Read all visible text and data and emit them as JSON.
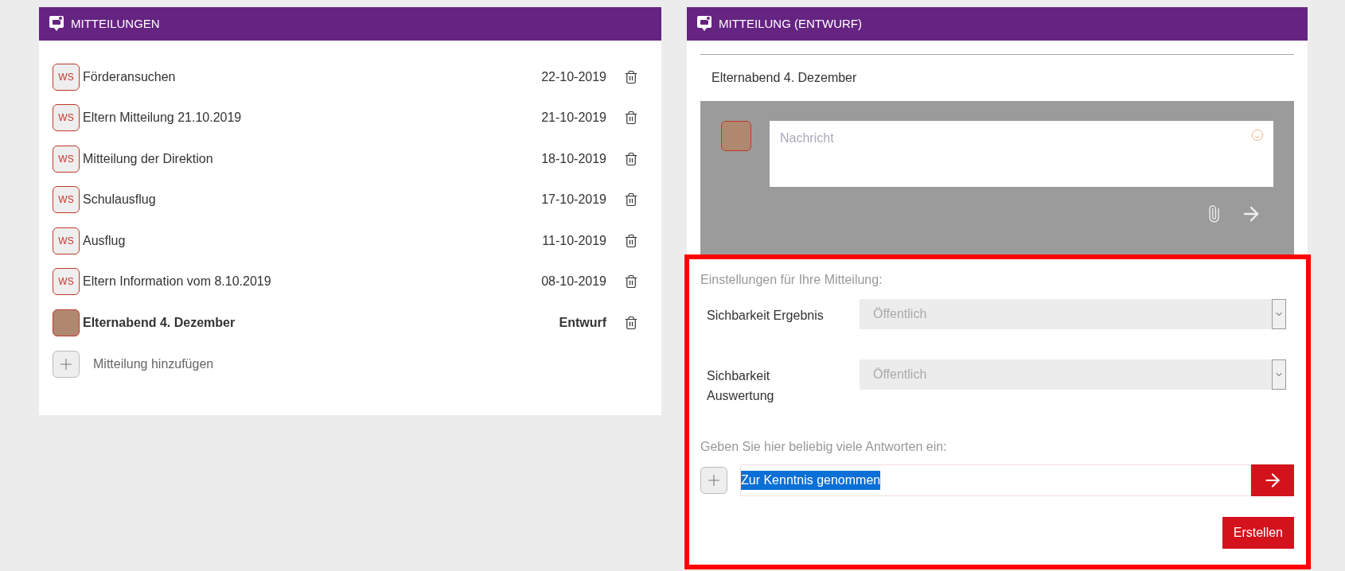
{
  "list_panel": {
    "title": "MITTEILUNGEN",
    "items": [
      {
        "kind": "initials",
        "initials": "WS",
        "title": "Förderansuchen",
        "date": "22-10-2019",
        "draft": false
      },
      {
        "kind": "initials",
        "initials": "WS",
        "title": "Eltern Mitteilung 21.10.2019",
        "date": "21-10-2019",
        "draft": false
      },
      {
        "kind": "initials",
        "initials": "WS",
        "title": "Mitteilung der Direktion",
        "date": "18-10-2019",
        "draft": false
      },
      {
        "kind": "initials",
        "initials": "WS",
        "title": "Schulausflug",
        "date": "17-10-2019",
        "draft": false
      },
      {
        "kind": "initials",
        "initials": "WS",
        "title": "Ausflug",
        "date": "11-10-2019",
        "draft": false
      },
      {
        "kind": "initials",
        "initials": "WS",
        "title": "Eltern Information vom 8.10.2019",
        "date": "08-10-2019",
        "draft": false
      },
      {
        "kind": "photo",
        "title": "Elternabend 4. Dezember",
        "date": "Entwurf",
        "draft": true
      }
    ],
    "add_label": "Mitteilung hinzufügen"
  },
  "draft_panel": {
    "title": "MITTEILUNG (ENTWURF)",
    "subject": "Elternabend 4. Dezember",
    "message": {
      "placeholder": "Nachricht"
    },
    "settings": {
      "heading": "Einstellungen für Ihre Mitteilung:",
      "fields": [
        {
          "label": "Sichbarkeit Ergebnis",
          "value": "Öffentlich"
        },
        {
          "label": "Sichbarkeit Auswertung",
          "value": "Öffentlich"
        }
      ]
    },
    "answers": {
      "heading": "Geben Sie hier beliebig viele Antworten ein:",
      "value": "Zur Kenntnis genommen",
      "text_selected": true
    },
    "create_button": "Erstellen"
  }
}
